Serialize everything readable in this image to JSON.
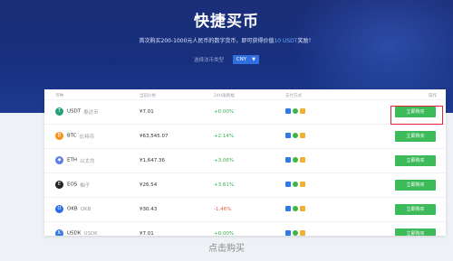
{
  "hero": {
    "title": "快捷买币",
    "subtitle_before": "首次购买200-1000元人民币的数字货币，即可获得价值",
    "subtitle_highlight": "10 USDT",
    "subtitle_after": "奖励！",
    "currency_label": "选择法币类型",
    "currency_value": "CNY"
  },
  "table": {
    "headers": [
      "币种",
      "当前价格",
      "24H涨跌幅",
      "支付方式",
      "操作"
    ],
    "rows": [
      {
        "symbol": "USDT",
        "name_cn": "泰达币",
        "icon_char": "T",
        "icon_color": "#26a17b",
        "price": "¥7.01",
        "change": "+0.00%",
        "trend": "up",
        "action": "立即购买"
      },
      {
        "symbol": "BTC",
        "name_cn": "比特币",
        "icon_char": "₿",
        "icon_color": "#f7931a",
        "price": "¥63,545.07",
        "change": "+2.14%",
        "trend": "up",
        "action": "立即购买"
      },
      {
        "symbol": "ETH",
        "name_cn": "以太坊",
        "icon_char": "◆",
        "icon_color": "#627eea",
        "price": "¥1,647.36",
        "change": "+3.06%",
        "trend": "up",
        "action": "立即购买"
      },
      {
        "symbol": "EOS",
        "name_cn": "柚子",
        "icon_char": "E",
        "icon_color": "#222222",
        "price": "¥26.54",
        "change": "+3.61%",
        "trend": "up",
        "action": "立即购买"
      },
      {
        "symbol": "OKB",
        "name_cn": "OKB",
        "icon_char": "O",
        "icon_color": "#2b6de8",
        "price": "¥30.43",
        "change": "-1.46%",
        "trend": "down",
        "action": "立即购买"
      },
      {
        "symbol": "USDK",
        "name_cn": "USDK",
        "icon_char": "K",
        "icon_color": "#3a7be0",
        "price": "¥7.01",
        "change": "+0.00%",
        "trend": "up",
        "action": "立即购买"
      }
    ]
  },
  "footer_label": "点击购买",
  "colors": {
    "hero_bg": "#1b2e78",
    "buy_button": "#3dbb5b",
    "up": "#37b24d",
    "down": "#e8574a",
    "highlight": "#e0262d"
  }
}
